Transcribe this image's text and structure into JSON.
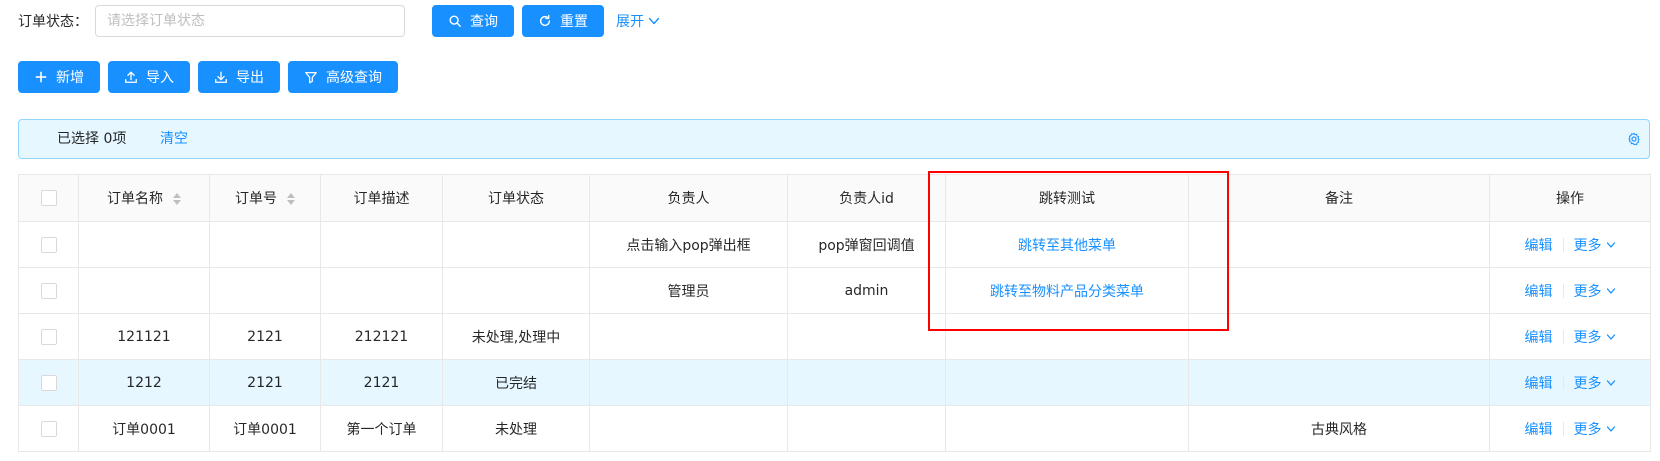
{
  "search": {
    "label": "订单状态：",
    "placeholder": "请选择订单状态",
    "search_button": "查询",
    "reset_button": "重置",
    "expand_link": "展开"
  },
  "toolbar": {
    "add": "新增",
    "import": "导入",
    "export": "导出",
    "advanced_query": "高级查询"
  },
  "alert": {
    "selected_prefix": "已选择",
    "selected_count": "0",
    "selected_suffix": "项",
    "clear": "清空"
  },
  "table": {
    "columns": [
      "订单名称",
      "订单号",
      "订单描述",
      "订单状态",
      "负责人",
      "负责人id",
      "跳转测试",
      "备注",
      "操作"
    ],
    "rows": [
      {
        "order_name": "",
        "order_no": "",
        "desc": "",
        "status": "",
        "owner": "点击输入pop弹出框",
        "owner_id": "pop弹窗回调值",
        "jump": "跳转至其他菜单",
        "remark": ""
      },
      {
        "order_name": "",
        "order_no": "",
        "desc": "",
        "status": "",
        "owner": "管理员",
        "owner_id": "admin",
        "jump": "跳转至物料产品分类菜单",
        "remark": ""
      },
      {
        "order_name": "121121",
        "order_no": "2121",
        "desc": "212121",
        "status": "未处理,处理中",
        "owner": "",
        "owner_id": "",
        "jump": "",
        "remark": ""
      },
      {
        "order_name": "1212",
        "order_no": "2121",
        "desc": "2121",
        "status": "已完结",
        "owner": "",
        "owner_id": "",
        "jump": "",
        "remark": ""
      },
      {
        "order_name": "订单0001",
        "order_no": "订单0001",
        "desc": "第一个订单",
        "status": "未处理",
        "owner": "",
        "owner_id": "",
        "jump": "",
        "remark": "古典风格"
      }
    ],
    "edit_label": "编辑",
    "more_label": "更多"
  },
  "colors": {
    "primary": "#1890ff",
    "alert_bg": "#e6f7ff",
    "highlight": "#ff0000"
  }
}
